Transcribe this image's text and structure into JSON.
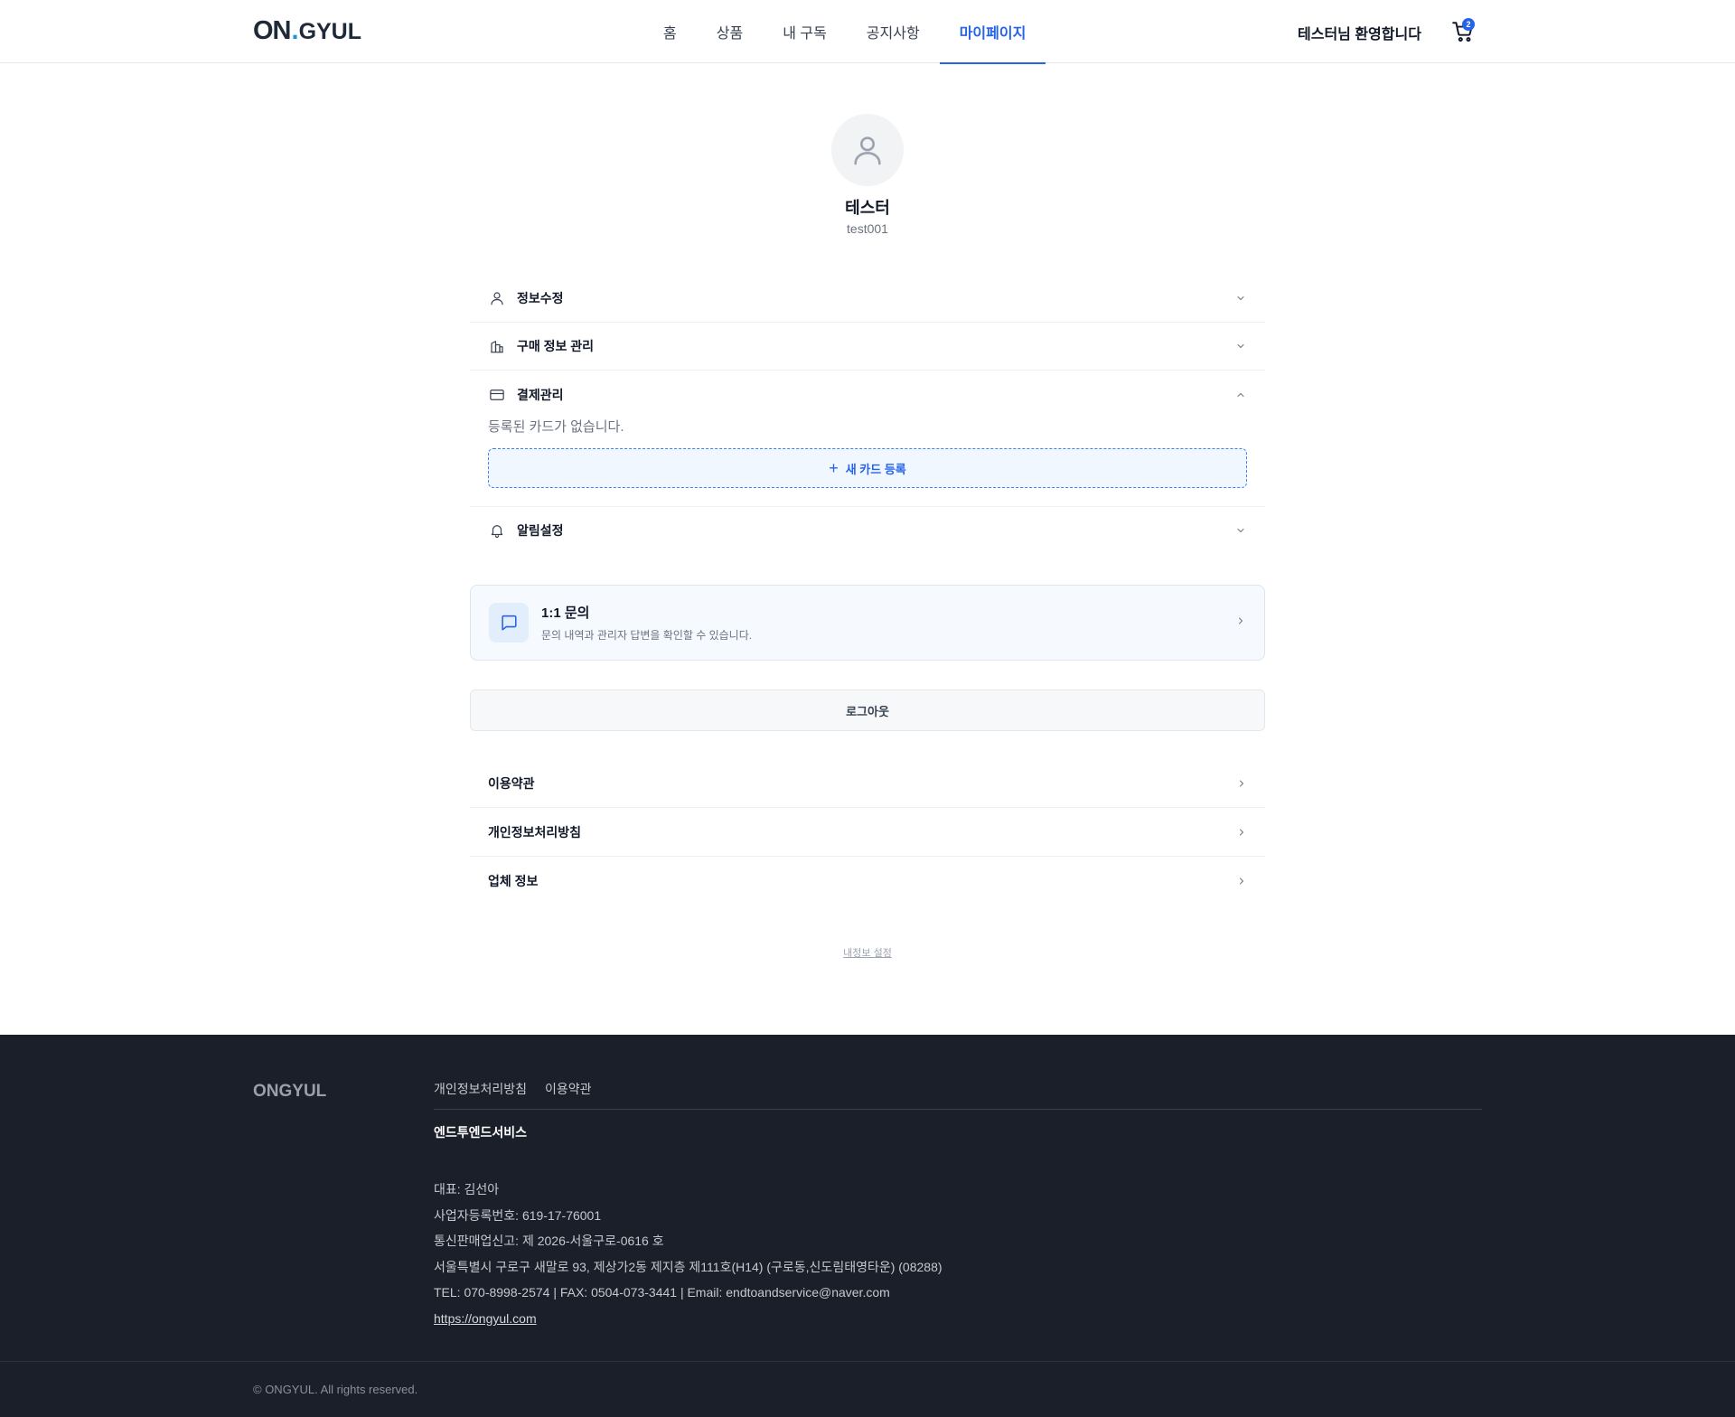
{
  "header": {
    "logo_main": "ON",
    "logo_dot": ".",
    "logo_sub": "GYUL",
    "nav": [
      {
        "label": "홈"
      },
      {
        "label": "상품"
      },
      {
        "label": "내 구독"
      },
      {
        "label": "공지사항"
      },
      {
        "label": "마이페이지"
      }
    ],
    "welcome": "테스터님 환영합니다",
    "cart_icon": "cart-icon",
    "cart_count": "2"
  },
  "profile": {
    "name": "테스터",
    "user_id": "test001",
    "avatar_icon": "user-icon"
  },
  "accordion": {
    "edit_info": {
      "label": "정보수정",
      "icon": "user-icon"
    },
    "purchase": {
      "label": "구매 정보 관리",
      "icon": "building-icon"
    },
    "payment": {
      "label": "결제관리",
      "icon": "credit-card-icon",
      "empty_text": "등록된 카드가 없습니다.",
      "add_label": "새 카드 등록",
      "add_icon": "+"
    },
    "notification": {
      "label": "알림설정",
      "icon": "bell-icon"
    }
  },
  "inquiry": {
    "title": "1:1 문의",
    "description": "문의 내역과 관리자 답변을 확인할 수 있습니다.",
    "icon": "chat-icon"
  },
  "logout_label": "로그아웃",
  "links": [
    {
      "label": "이용약관"
    },
    {
      "label": "개인정보처리방침"
    },
    {
      "label": "업체 정보"
    }
  ],
  "small_link": "내정보 설정",
  "footer": {
    "logo": "ONGYUL",
    "links": [
      "개인정보처리방침",
      "이용약관"
    ],
    "company": "엔드투엔드서비스",
    "ceo": "대표: 김선아",
    "business_no": "사업자등록번호: 619-17-76001",
    "ecommerce_no": "통신판매업신고: 제 2026-서울구로-0616 호",
    "address": "서울특별시 구로구 새말로 93, 제상가2동 제지층 제111호(H14) (구로동,신도림태영타운) (08288)",
    "contact": "TEL: 070-8998-2574 | FAX: 0504-073-3441 | Email: endtoandservice@naver.com",
    "url": "https://ongyul.com",
    "copyright": "© ONGYUL. All rights reserved."
  },
  "colors": {
    "accent": "#2563eb",
    "footer_bg": "#1b1f29"
  }
}
